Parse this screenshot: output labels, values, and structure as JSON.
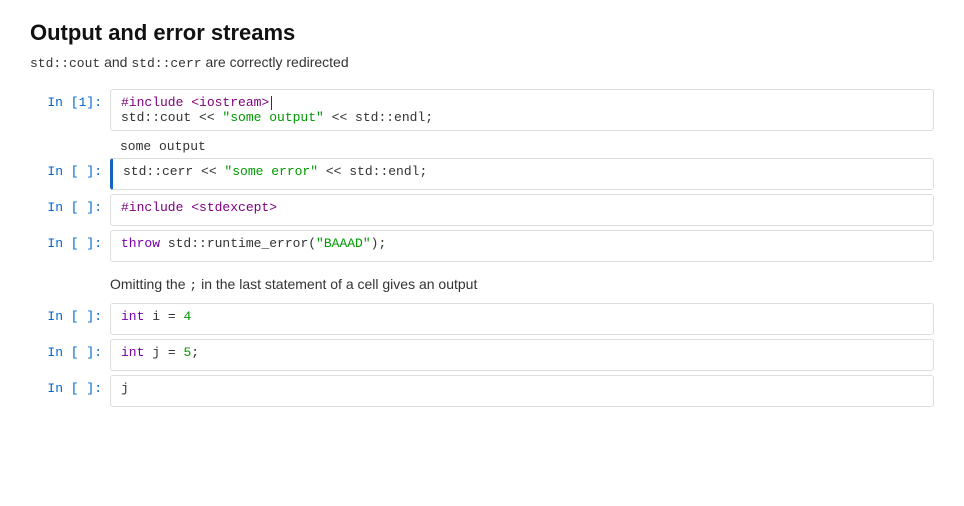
{
  "title": "Output and error streams",
  "description_parts": [
    {
      "text": "std::cout",
      "code": true
    },
    {
      "text": " and ",
      "code": false
    },
    {
      "text": "std::cerr",
      "code": true
    },
    {
      "text": " are correctly redirected",
      "code": false
    }
  ],
  "cells": [
    {
      "id": "cell1",
      "label_prefix": "In [",
      "label_num": "1",
      "label_suffix": "]:",
      "active": false,
      "lines": [
        {
          "html": "<span class='kw-blue'>#include &lt;iostream&gt;</span><span class='cursor'></span>"
        },
        {
          "html": "std::cout &lt;&lt; <span class='kw-green'>\"some output\"</span> &lt;&lt; std::endl;"
        }
      ],
      "output": "some output"
    },
    {
      "id": "cell2",
      "label_prefix": "In [",
      "label_num": " ",
      "label_suffix": "]:",
      "active": true,
      "lines": [
        {
          "html": "std::cerr &lt;&lt; <span class='kw-green'>\"some error\"</span> &lt;&lt; std::endl;"
        }
      ],
      "output": null
    },
    {
      "id": "cell3",
      "label_prefix": "In [",
      "label_num": " ",
      "label_suffix": "]:",
      "active": false,
      "lines": [
        {
          "html": "<span class='kw-blue'>#include &lt;stdexcept&gt;</span>"
        }
      ],
      "output": null
    },
    {
      "id": "cell4",
      "label_prefix": "In [",
      "label_num": " ",
      "label_suffix": "]:",
      "active": false,
      "lines": [
        {
          "html": "<span class='kw-keyword'>throw</span> std::runtime_error(<span class='kw-green'>\"BAAAD\"</span>);"
        }
      ],
      "output": null
    }
  ],
  "separator": "Omitting the ; in the last statement of a cell gives an output",
  "cells2": [
    {
      "id": "cell5",
      "label_prefix": "In [",
      "label_num": " ",
      "label_suffix": "]:",
      "active": false,
      "lines": [
        {
          "html": "<span class='kw-keyword'>int</span> i <span class='kw-dark'>=</span> <span class='kw-purple'>4</span>"
        }
      ],
      "output": null
    },
    {
      "id": "cell6",
      "label_prefix": "In [",
      "label_num": " ",
      "label_suffix": "]:",
      "active": false,
      "lines": [
        {
          "html": "<span class='kw-keyword'>int</span> j <span class='kw-dark'>=</span> <span class='kw-purple'>5</span>;"
        }
      ],
      "output": null
    },
    {
      "id": "cell7",
      "label_prefix": "In [",
      "label_num": " ",
      "label_suffix": "]:",
      "active": false,
      "lines": [
        {
          "html": "j"
        }
      ],
      "output": null
    }
  ]
}
